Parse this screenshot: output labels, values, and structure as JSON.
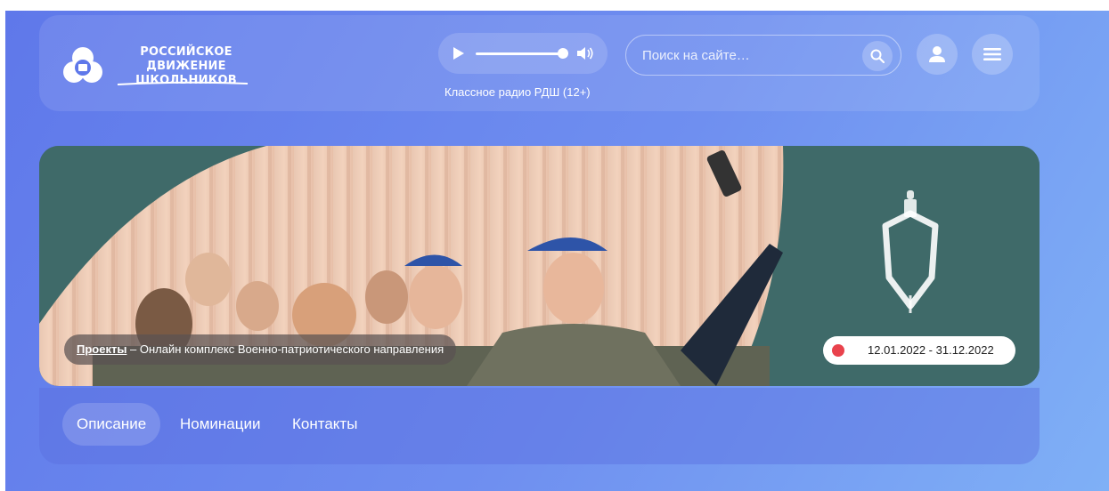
{
  "header": {
    "logo": {
      "line1": "РОССИЙСКОЕ",
      "line2": "ДВИЖЕНИЕ ШКОЛЬНИКОВ"
    },
    "radio": {
      "label": "Классное радио РДШ (12+)",
      "progress": 1.0
    },
    "search": {
      "placeholder": "Поиск на сайте…"
    },
    "icons": [
      "logo-icon",
      "play-icon",
      "volume-icon",
      "search-icon",
      "user-icon",
      "menu-icon"
    ]
  },
  "banner": {
    "breadcrumb": {
      "link": "Проекты",
      "rest": " – Онлайн комплекс Военно-патриотического направления"
    },
    "dates": "12.01.2022 - 31.12.2022",
    "colors": {
      "panel": "#3f6a69",
      "status_dot": "#e9424c"
    }
  },
  "tabs": [
    {
      "label": "Описание",
      "active": true
    },
    {
      "label": "Номинации",
      "active": false
    },
    {
      "label": "Контакты",
      "active": false
    }
  ],
  "colors": {
    "gradient_start": "#5f78ea",
    "gradient_end": "#7fb0f6"
  }
}
